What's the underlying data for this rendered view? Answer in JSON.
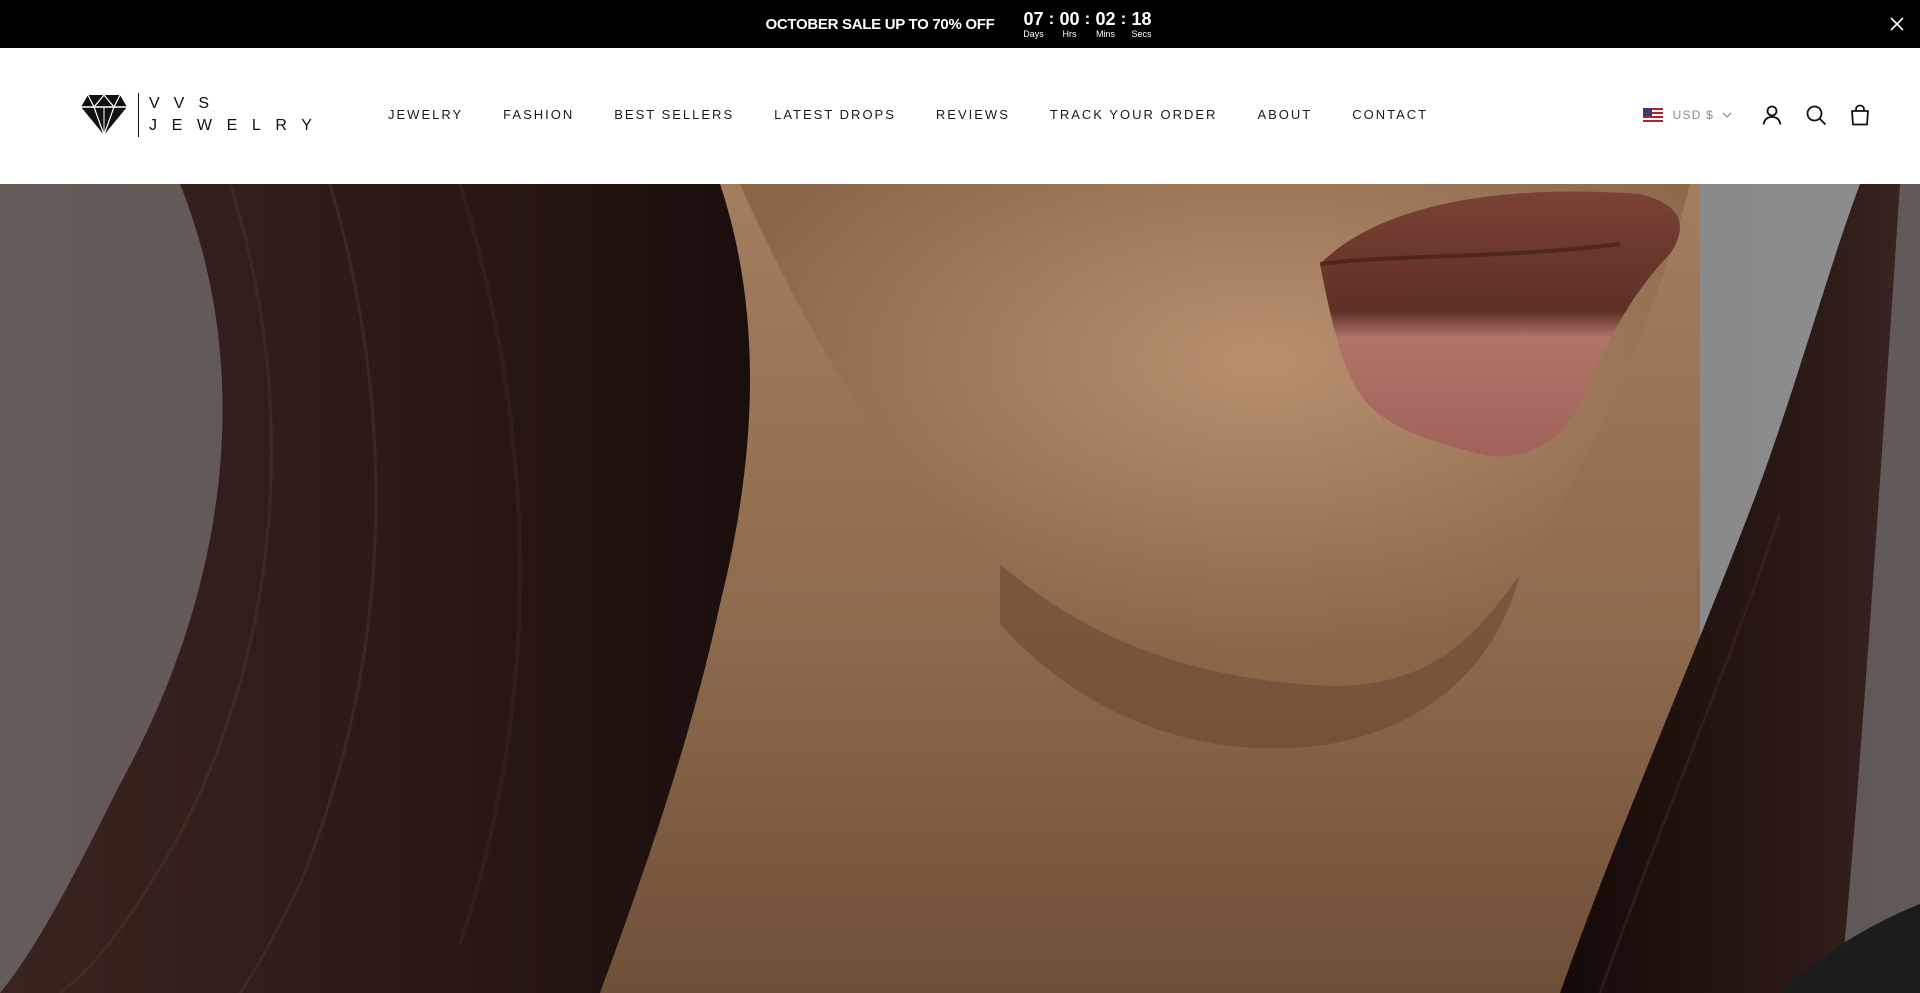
{
  "announcement": {
    "text": "OCTOBER SALE UP TO 70% OFF",
    "countdown": [
      {
        "value": "07",
        "label": "Days"
      },
      {
        "value": "00",
        "label": "Hrs"
      },
      {
        "value": "02",
        "label": "Mins"
      },
      {
        "value": "18",
        "label": "Secs"
      }
    ],
    "separator": ":",
    "close_icon": "close-icon"
  },
  "header": {
    "logo": {
      "line1": "VVS",
      "line2": "JEWELRY",
      "icon": "diamond-icon"
    },
    "nav": [
      {
        "label": "JEWELRY"
      },
      {
        "label": "FASHION"
      },
      {
        "label": "BEST SELLERS"
      },
      {
        "label": "LATEST DROPS"
      },
      {
        "label": "REVIEWS"
      },
      {
        "label": "TRACK YOUR ORDER"
      },
      {
        "label": "ABOUT"
      },
      {
        "label": "CONTACT"
      }
    ],
    "currency": {
      "label": "USD $",
      "flag_icon": "us-flag-icon",
      "chevron_icon": "chevron-down-icon"
    },
    "icons": [
      "account-icon",
      "search-icon",
      "cart-icon"
    ]
  },
  "hero": {
    "image": "hero-model-image"
  },
  "colors": {
    "announcement_bg": "#000000",
    "announcement_text": "#ffffff",
    "header_bg": "#ffffff",
    "nav_text": "#1a1a1a",
    "currency_text": "#8a8a8a"
  }
}
